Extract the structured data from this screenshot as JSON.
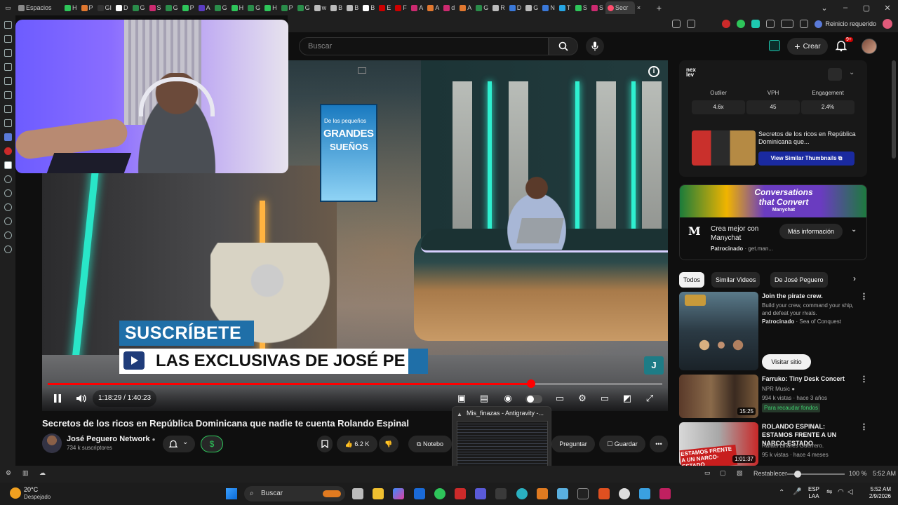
{
  "browser": {
    "tabs": [
      {
        "label": "Espacios",
        "color": "#8a8a8a"
      },
      {
        "label": "H",
        "color": "#2ec55a"
      },
      {
        "label": "P",
        "color": "#e0772f"
      },
      {
        "label": "GI",
        "color": "#333333"
      },
      {
        "label": "D",
        "color": "#ffffff"
      },
      {
        "label": "G",
        "color": "#2a8c4a"
      },
      {
        "label": "S",
        "color": "#cc2a70"
      },
      {
        "label": "G",
        "color": "#2a8c4a"
      },
      {
        "label": "P",
        "color": "#2ec55a"
      },
      {
        "label": "A",
        "color": "#5a3cc0"
      },
      {
        "label": "G",
        "color": "#2a8c4a"
      },
      {
        "label": "H",
        "color": "#2ec55a"
      },
      {
        "label": "G",
        "color": "#2a8c4a"
      },
      {
        "label": "H",
        "color": "#2ec55a"
      },
      {
        "label": "P",
        "color": "#2a8c4a"
      },
      {
        "label": "G",
        "color": "#2a8c4a"
      },
      {
        "label": "w",
        "color": "#bbbbbb"
      },
      {
        "label": "B",
        "color": "#bbbbbb"
      },
      {
        "label": "B",
        "color": "#bbbbbb"
      },
      {
        "label": "B",
        "color": "#ffffff"
      },
      {
        "label": "E",
        "color": "#cc0000"
      },
      {
        "label": "F",
        "color": "#cc0000"
      },
      {
        "label": "A",
        "color": "#cc2a70"
      },
      {
        "label": "A",
        "color": "#e0772f"
      },
      {
        "label": "d",
        "color": "#cc2a70"
      },
      {
        "label": "A",
        "color": "#e0772f"
      },
      {
        "label": "G",
        "color": "#2a8c4a"
      },
      {
        "label": "R",
        "color": "#bbbbbb"
      },
      {
        "label": "D",
        "color": "#3a78d8"
      },
      {
        "label": "G",
        "color": "#bbbbbb"
      },
      {
        "label": "N",
        "color": "#3a78d8"
      },
      {
        "label": "T",
        "color": "#26a5e4"
      },
      {
        "label": "S",
        "color": "#2ec55a"
      },
      {
        "label": "S",
        "color": "#cc2a70"
      }
    ],
    "active_tab": "Secr",
    "reinicio": "Reinicio requerido",
    "new_tab": "+"
  },
  "yt_header": {
    "search_placeholder": "Buscar",
    "crear": "Crear",
    "notif_badge": "9+"
  },
  "player": {
    "book": {
      "line1": "De los pequeños",
      "line2": "GRANDES",
      "line3": "SUEÑOS"
    },
    "overlay_subscribe": "SUSCRÍBETE",
    "overlay_exclusivas": "LAS EXCLUSIVAS DE JOSÉ PE",
    "jp_logo": "J",
    "info": "i",
    "time": "1:18:29 / 1:40:23",
    "progress": 0.786
  },
  "video": {
    "title": "Secretos de los ricos en República Dominicana que nadie te cuenta Rolando Espinal",
    "channel": "José Peguero Network",
    "subscribers": "734 k suscriptores",
    "likes": "6.2 K",
    "notebook": "Notebo",
    "preguntar": "Preguntar",
    "guardar": "Guardar",
    "dollar": "$",
    "more": "•••"
  },
  "taskbar_popup": {
    "title": "Mis_finazas - Antigravity -..."
  },
  "extension": {
    "logo": "nex lev",
    "metrics": [
      {
        "label": "Outlier",
        "value": "4.6x"
      },
      {
        "label": "VPH",
        "value": "45"
      },
      {
        "label": "Engagement",
        "value": "2.4%"
      }
    ],
    "video_title": "Secretos de los ricos en República Dominicana que...",
    "similar_button": "View Similar Thumbnails ⧉"
  },
  "ad": {
    "banner_line1": "Conversations",
    "banner_line2": "that Convert",
    "banner_line3": "Manychat",
    "logo": "M",
    "title": "Crea mejor con Manychat",
    "sponsor_label": "Patrocinado",
    "sponsor_url": "· get.man...",
    "button": "Más información"
  },
  "chips": [
    "Todos",
    "Similar Videos",
    "De José Peguero"
  ],
  "recommendations": [
    {
      "title": "Join the pirate crew.",
      "lines": [
        "Build your crew, command your ship,",
        "and defeat your rivals."
      ],
      "sponsor": "Patrocinado",
      "sponsor_by": "· Sea of Conquest",
      "button": "Visitar sitio",
      "duration": ""
    },
    {
      "title": "Farruko: Tiny Desk Concert",
      "channel": "NPR Music",
      "meta": "994 k vistas · hace 3 años",
      "tag": "Para recaudar fondos",
      "duration": "15:25"
    },
    {
      "title": "ROLANDO ESPINAL: ESTAMOS FRENTE A UN NARCO-ESTADO",
      "channel": "Rafael Linares Guerrero.",
      "meta": "95 k vistas · hace 4 meses",
      "duration": "1:01:37",
      "thumb_text": "ESTAMOS FRENTE A UN NARCO- ESTADO"
    }
  ],
  "statusbar": {
    "restablecer": "Restablecer",
    "zoom": "100 %",
    "time": "5:52 AM"
  },
  "taskbar": {
    "weather_temp": "20°C",
    "weather_desc": "Despejado",
    "search": "Buscar",
    "lang1": "ESP",
    "lang2": "LAA",
    "clock_time": "5:52 AM",
    "clock_date": "2/9/2026"
  }
}
